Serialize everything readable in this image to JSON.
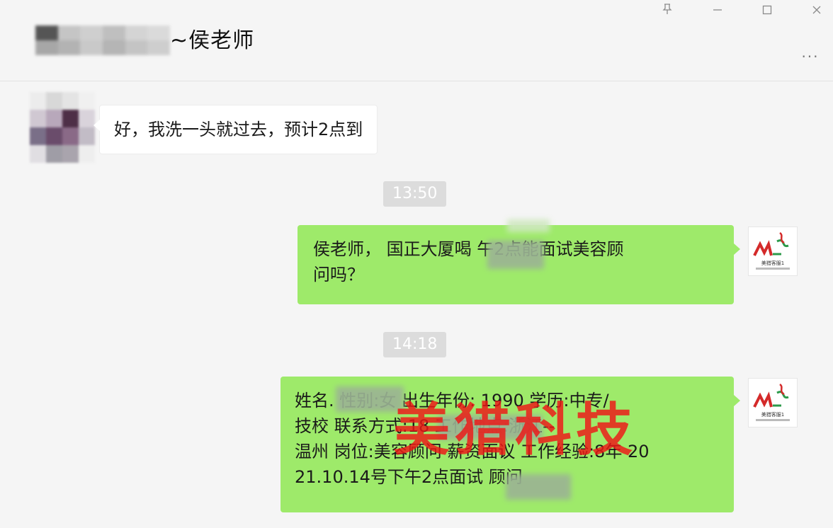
{
  "window": {
    "title": "~侯老师",
    "pin_icon": "pin-icon",
    "minimize_icon": "minimize-icon",
    "maximize_icon": "maximize-icon",
    "close_icon": "close-icon",
    "more_label": "..."
  },
  "messages": [
    {
      "side": "left",
      "text": "好，我洗一头就过去，预计2点到"
    },
    {
      "time": "13:50"
    },
    {
      "side": "right",
      "line1": "侯老师，  国正大厦喝          午2点能面试美容顾",
      "line2": "问吗？"
    },
    {
      "time": "14:18"
    },
    {
      "side": "right",
      "lines": [
        "姓名.            性别:女  出生年份: 1990 学历:中专/",
        "技校 联系方式:18            工作地点:浙江--",
        "温州 岗位:美容顾问 薪资面议 工作经验:8年 20",
        "21.10.14号下午2点面试            顾问"
      ]
    }
  ],
  "avatar_right_logo": {
    "mark": "ML",
    "caption": "美猎客服1"
  },
  "watermark": "美猎科技",
  "colors": {
    "bubble_out": "#9eea6a",
    "bubble_in": "#ffffff",
    "watermark": "#ee1616"
  }
}
